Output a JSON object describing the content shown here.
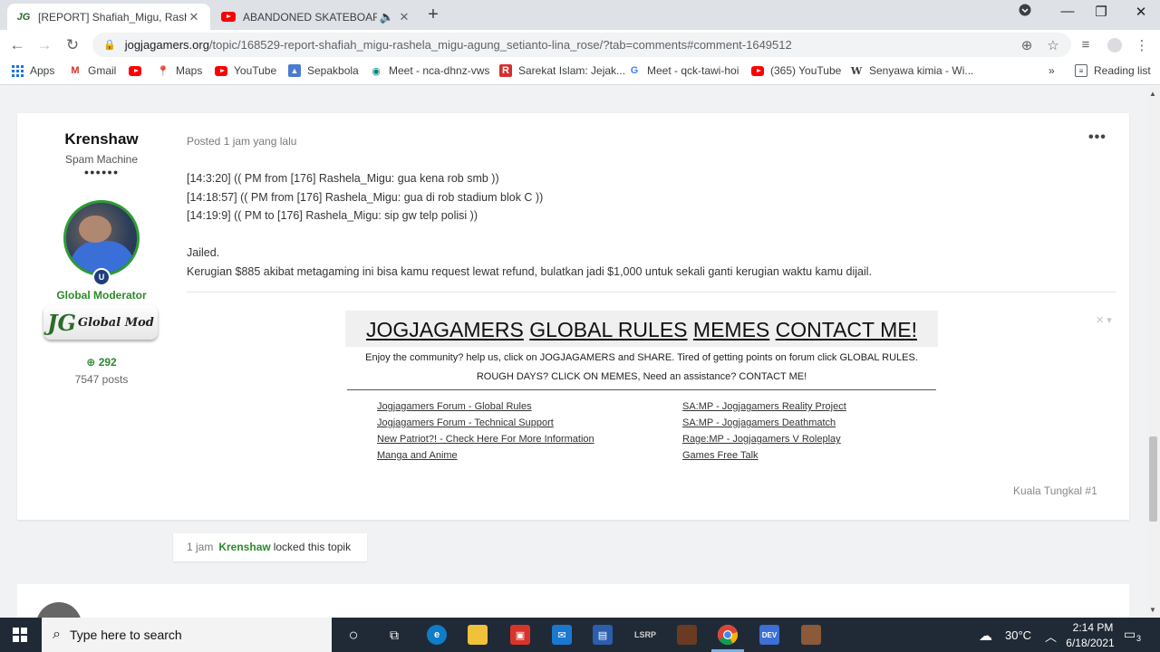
{
  "browser": {
    "tabs": [
      {
        "title": "[REPORT] Shafiah_Migu, Rashela_",
        "favicon": "JG",
        "close": "✕"
      },
      {
        "title": "ABANDONED SKATEBOARD",
        "favicon": "youtube-icon",
        "audio": "🔈",
        "close": "✕"
      }
    ],
    "new_tab": "+",
    "url_host": "jogjagamers.org",
    "url_path": "/topic/168529-report-shafiah_migu-rashela_migu-agung_setianto-lina_rose/?tab=comments#comment-1649512",
    "bookmarks": [
      {
        "label": "Apps"
      },
      {
        "label": "Gmail"
      },
      {
        "label": ""
      },
      {
        "label": "Maps"
      },
      {
        "label": "YouTube"
      },
      {
        "label": "Sepakbola"
      },
      {
        "label": "Meet - nca-dhnz-vws"
      },
      {
        "label": "Sarekat Islam: Jejak..."
      },
      {
        "label": "Meet - qck-tawi-hoi"
      },
      {
        "label": "(365) YouTube"
      },
      {
        "label": "Senyawa kimia - Wi..."
      }
    ],
    "more_bookmarks": "»",
    "reading_list": "Reading list"
  },
  "post": {
    "author": {
      "name": "Krenshaw",
      "rank": "Spam Machine",
      "pips": "●●●●●●",
      "group": "Global Moderator",
      "badge_text": "Global Mod",
      "badge_big": "JG",
      "reputation": "292",
      "posts": "7547 posts"
    },
    "meta": "Posted 1 jam yang lalu",
    "menu": "•••",
    "lines": [
      "[14:3:20] (( PM from [176] Rashela_Migu: gua kena rob smb ))",
      "[14:18:57] (( PM from [176] Rashela_Migu: gua di rob stadium blok C ))",
      "[14:19:9] (( PM to [176] Rashela_Migu: sip gw telp polisi ))",
      "Jailed.",
      "Kerugian $885 akibat metagaming ini bisa kamu request lewat refund, bulatkan jadi $1,000 untuk sekali ganti kerugian waktu kamu dijail."
    ],
    "signature": {
      "banner": [
        "JOGJAGAMERS",
        "GLOBAL RULES",
        "MEMES",
        "CONTACT ME!"
      ],
      "blurb1": "Enjoy the community? help us, click on JOGJAGAMERS and SHARE. Tired of getting points on forum click GLOBAL RULES.",
      "blurb2": "ROUGH DAYS? CLICK ON MEMES, Need an assistance? CONTACT ME!",
      "links_left": [
        "Jogjagamers Forum - Global Rules",
        "Jogjagamers Forum - Technical Support",
        "New Patriot?! - Check Here For More Information",
        "Manga and Anime"
      ],
      "links_right": [
        "SA:MP - Jogjagamers Reality Project",
        "SA:MP - Jogjagamers Deathmatch",
        "Rage:MP - Jogjagamers V Roleplay",
        "Games Free Talk"
      ],
      "close": "✕ ▾"
    },
    "footer": "Kuala Tungkal #1"
  },
  "event": {
    "time": "1 jam",
    "who": "Krenshaw",
    "action": "locked this topik"
  },
  "taskbar": {
    "search_placeholder": "Type here to search",
    "temperature": "30°C",
    "time": "2:14 PM",
    "date": "6/18/2021",
    "notifications": "3",
    "lsrp": "LSRP"
  },
  "colors": {
    "accent_green": "#2b8a2b",
    "tab_strip": "#dee1e6",
    "taskbar": "#202a36"
  }
}
